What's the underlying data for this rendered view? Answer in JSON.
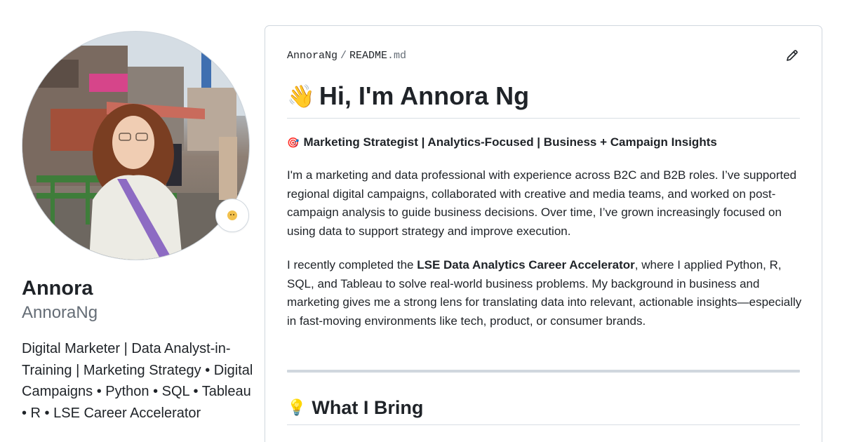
{
  "profile": {
    "name": "Annora",
    "login": "AnnoraNg",
    "bio": "Digital Marketer | Data Analyst-in-Training | Marketing Strategy • Digital Campaigns • Python • SQL • Tableau • R • LSE Career Accelerator",
    "status_icon": "smiley-emoji-icon",
    "avatar_icon": "profile-photo"
  },
  "readme": {
    "path_owner": "AnnoraNg",
    "path_separator": "/",
    "path_file": "README",
    "path_ext": ".md",
    "edit_icon": "pencil-icon",
    "heading_emoji": "👋",
    "heading": "Hi, I'm Annora Ng",
    "tagline_emoji": "🎯",
    "tagline": "Marketing Strategist | Analytics-Focused | Business + Campaign Insights",
    "paragraph1": "I'm a marketing and data professional with experience across B2C and B2B roles. I’ve supported regional digital campaigns, collaborated with creative and media teams, and worked on post-campaign analysis to guide business decisions. Over time, I’ve grown increasingly focused on using data to support strategy and improve execution.",
    "paragraph2_before": "I recently completed the ",
    "paragraph2_bold": "LSE Data Analytics Career Accelerator",
    "paragraph2_after": ", where I applied Python, R, SQL, and Tableau to solve real-world business problems. My background in business and marketing gives me a strong lens for translating data into relevant, actionable insights—especially in fast-moving environments like tech, product, or consumer brands.",
    "section_emoji": "💡",
    "section_heading": "What I Bring"
  },
  "colors": {
    "text": "#1f2328",
    "muted": "#656d76",
    "border": "#d0d7de"
  }
}
